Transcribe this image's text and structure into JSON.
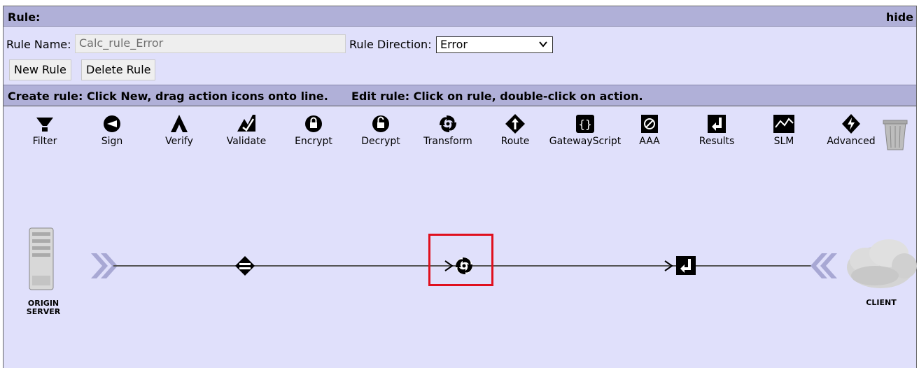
{
  "panel": {
    "title": "Rule:",
    "hide_label": "hide"
  },
  "rule_form": {
    "name_label": "Rule Name:",
    "name_value": "Calc_rule_Error",
    "direction_label": "Rule Direction:",
    "direction_value": "Error",
    "new_button": "New Rule",
    "delete_button": "Delete Rule"
  },
  "instructions": {
    "create": "Create rule: Click New, drag action icons onto line.",
    "edit": "Edit rule: Click on rule, double-click on action."
  },
  "palette": [
    {
      "label": "Filter",
      "icon": "filter-icon"
    },
    {
      "label": "Sign",
      "icon": "sign-icon"
    },
    {
      "label": "Verify",
      "icon": "verify-icon"
    },
    {
      "label": "Validate",
      "icon": "validate-icon"
    },
    {
      "label": "Encrypt",
      "icon": "encrypt-icon"
    },
    {
      "label": "Decrypt",
      "icon": "decrypt-icon"
    },
    {
      "label": "Transform",
      "icon": "transform-icon"
    },
    {
      "label": "Route",
      "icon": "route-icon"
    },
    {
      "label": "GatewayScript",
      "icon": "gatewayscript-icon"
    },
    {
      "label": "AAA",
      "icon": "aaa-icon"
    },
    {
      "label": "Results",
      "icon": "results-icon"
    },
    {
      "label": "SLM",
      "icon": "slm-icon"
    },
    {
      "label": "Advanced",
      "icon": "advanced-icon"
    }
  ],
  "trash_icon": "trash-icon",
  "pipeline": {
    "origin_label_1": "ORIGIN",
    "origin_label_2": "SERVER",
    "client_label": "CLIENT",
    "actions": [
      "match-icon",
      "transform-icon",
      "results-icon"
    ]
  },
  "colors": {
    "panel_bg": "#e0e0fb",
    "header_bg": "#b0b0d8",
    "highlight": "#e0101e"
  }
}
